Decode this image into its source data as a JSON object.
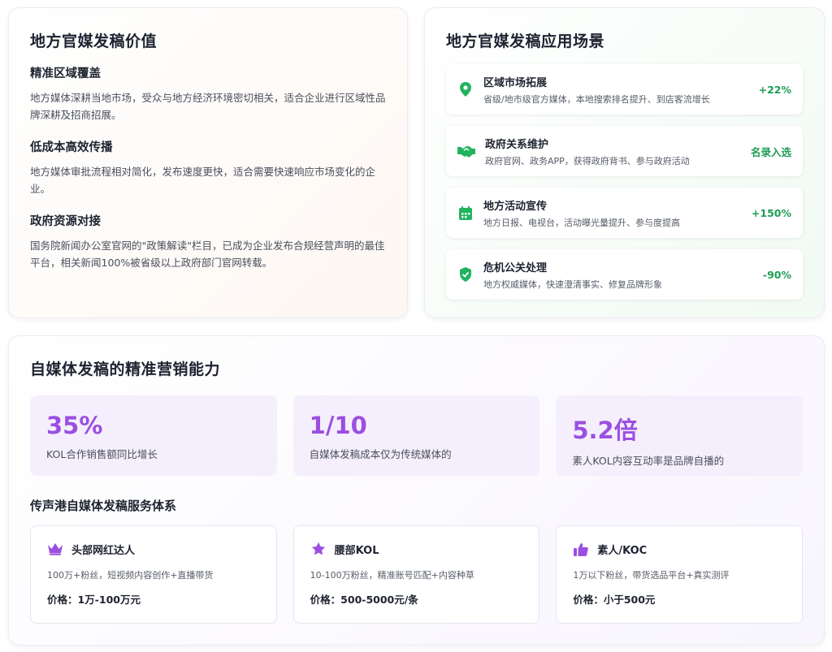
{
  "value_card": {
    "title": "地方官媒发稿价值",
    "items": [
      {
        "heading": "精准区域覆盖",
        "text": "地方媒体深耕当地市场，受众与地方经济环境密切相关，适合企业进行区域性品牌深耕及招商招展。"
      },
      {
        "heading": "低成本高效传播",
        "text": "地方媒体审批流程相对简化，发布速度更快，适合需要快速响应市场变化的企业。"
      },
      {
        "heading": "政府资源对接",
        "text": "国务院新闻办公室官网的\"政策解读\"栏目，已成为企业发布合规经营声明的最佳平台，相关新闻100%被省级以上政府部门官网转载。"
      }
    ]
  },
  "scenes_card": {
    "title": "地方官媒发稿应用场景",
    "accent": "#1f9d55",
    "items": [
      {
        "icon": "location-pin-icon",
        "title": "区域市场拓展",
        "desc": "省级/地市级官方媒体，本地搜索排名提升、到店客流增长",
        "metric": "+22%"
      },
      {
        "icon": "handshake-icon",
        "title": "政府关系维护",
        "desc": "政府官网、政务APP，获得政府背书、参与政府活动",
        "metric": "名录入选"
      },
      {
        "icon": "calendar-icon",
        "title": "地方活动宣传",
        "desc": "地方日报、电视台，活动曝光量提升、参与度提高",
        "metric": "+150%"
      },
      {
        "icon": "shield-check-icon",
        "title": "危机公关处理",
        "desc": "地方权威媒体，快速澄清事实、修复品牌形象",
        "metric": "-90%"
      }
    ]
  },
  "selfmedia_card": {
    "title": "自媒体发稿的精准营销能力",
    "accent": "#9b4fe0",
    "stats": [
      {
        "value": "35%",
        "label": "KOL合作销售额同比增长"
      },
      {
        "value": "1/10",
        "label": "自媒体发稿成本仅为传统媒体的"
      },
      {
        "value": "5.2倍",
        "label": "素人KOL内容互动率是品牌自播的"
      }
    ],
    "service_title": "传声港自媒体发稿服务体系",
    "tiers": [
      {
        "icon": "crown-icon",
        "name": "头部网红达人",
        "desc": "100万+粉丝，短视频内容创作+直播带货",
        "price": "价格：1万-100万元"
      },
      {
        "icon": "star-icon",
        "name": "腰部KOL",
        "desc": "10-100万粉丝，精准账号匹配+内容种草",
        "price": "价格：500-5000元/条"
      },
      {
        "icon": "thumbs-up-icon",
        "name": "素人/KOC",
        "desc": "1万以下粉丝，带货选品平台+真实测评",
        "price": "价格：小于500元"
      }
    ]
  }
}
